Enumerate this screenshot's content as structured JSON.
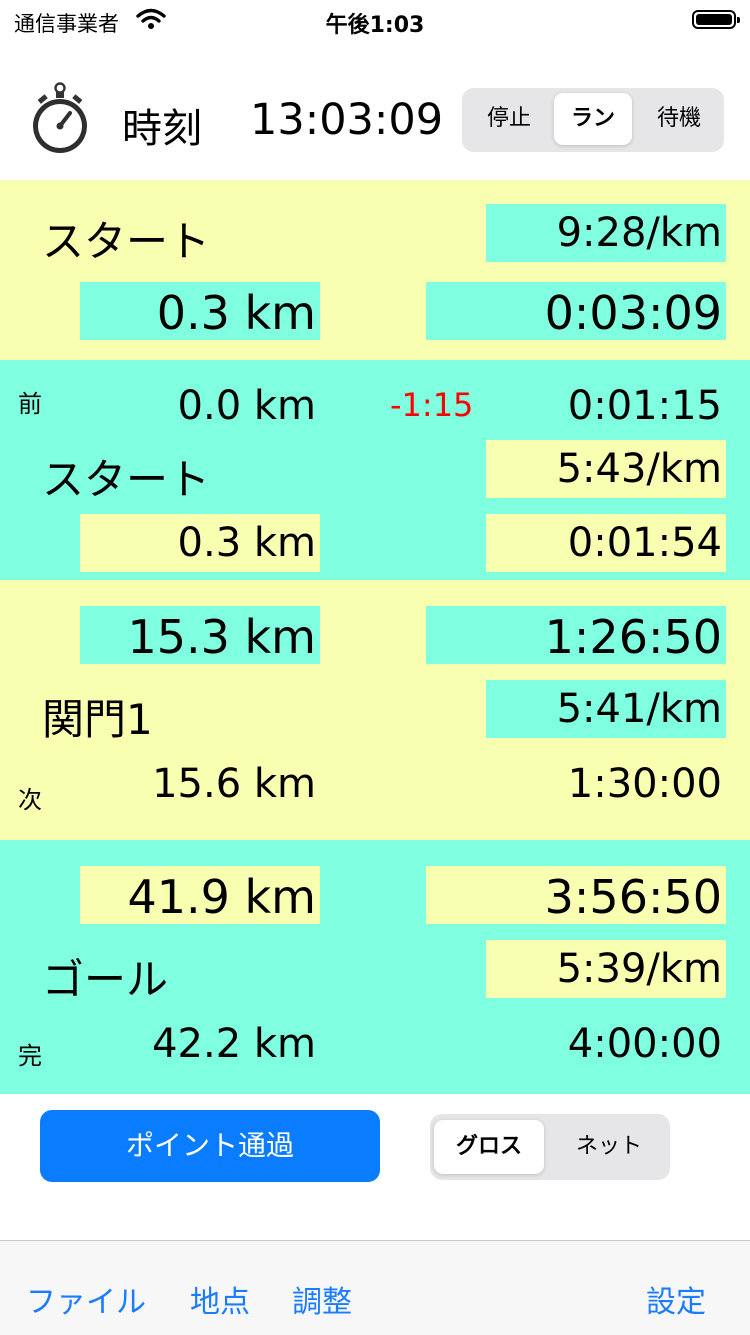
{
  "status_bar": {
    "carrier": "通信事業者",
    "time": "午後1:03"
  },
  "header": {
    "label": "時刻",
    "time": "13:03:09",
    "mode_segments": [
      "停止",
      "ラン",
      "待機"
    ],
    "mode_selected": "ラン"
  },
  "overall": {
    "name": "スタート",
    "pace": "9:28/km",
    "distance": "0.3 km",
    "elapsed": "0:03:09"
  },
  "previous": {
    "tag": "前",
    "distance": "0.0 km",
    "delta": "-1:15",
    "time": "0:01:15",
    "name": "スタート",
    "pace": "5:43/km",
    "since_distance": "0.3 km",
    "since_time": "0:01:54"
  },
  "next": {
    "remain_distance": "15.3 km",
    "eta": "1:26:50",
    "name": "関門1",
    "pace": "5:41/km",
    "tag": "次",
    "distance": "15.6 km",
    "time": "1:30:00"
  },
  "goal": {
    "remain_distance": "41.9 km",
    "eta": "3:56:50",
    "name": "ゴール",
    "pace": "5:39/km",
    "tag": "完",
    "distance": "42.2 km",
    "time": "4:00:00"
  },
  "actions": {
    "pass_button": "ポイント通過",
    "time_segments": [
      "グロス",
      "ネット"
    ],
    "time_selected": "グロス"
  },
  "toolbar": {
    "file": "ファイル",
    "points": "地点",
    "adjust": "調整",
    "settings": "設定"
  },
  "colors": {
    "yellow": "#f8ffb0",
    "cyan": "#80ffe0",
    "accent": "#0a7cff",
    "delta_red": "#ff0000"
  }
}
